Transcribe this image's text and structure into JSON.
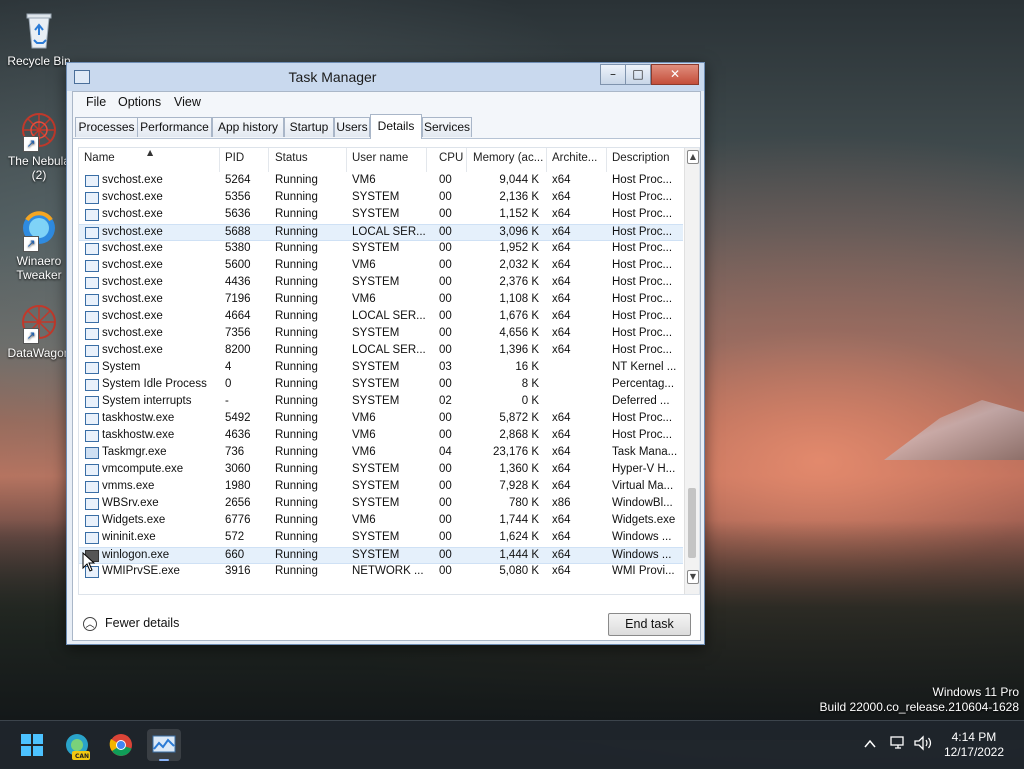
{
  "desktop": {
    "icons": [
      {
        "label": "Recycle Bin"
      },
      {
        "label": "The Nebula (2)"
      },
      {
        "label": "Winaero Tweaker"
      },
      {
        "label": "DataWagon"
      }
    ],
    "watermark": {
      "line1": "Windows 11 Pro",
      "line2": "Build 22000.co_release.210604-1628"
    }
  },
  "window": {
    "title": "Task Manager",
    "controls": {
      "minimize": "–",
      "maximize": "□",
      "close": "✕"
    },
    "menu": [
      "File",
      "Options",
      "View"
    ],
    "tabs": [
      "Processes",
      "Performance",
      "App history",
      "Startup",
      "Users",
      "Details",
      "Services"
    ],
    "active_tab": "Details",
    "columns": [
      "Name",
      "PID",
      "Status",
      "User name",
      "CPU",
      "Memory (ac...",
      "Archite...",
      "Description"
    ],
    "rows": [
      {
        "name": "svchost.exe",
        "pid": "5264",
        "status": "Running",
        "user": "VM6",
        "cpu": "00",
        "mem": "9,044 K",
        "arch": "x64",
        "desc": "Host Proc..."
      },
      {
        "name": "svchost.exe",
        "pid": "5356",
        "status": "Running",
        "user": "SYSTEM",
        "cpu": "00",
        "mem": "2,136 K",
        "arch": "x64",
        "desc": "Host Proc..."
      },
      {
        "name": "svchost.exe",
        "pid": "5636",
        "status": "Running",
        "user": "SYSTEM",
        "cpu": "00",
        "mem": "1,152 K",
        "arch": "x64",
        "desc": "Host Proc..."
      },
      {
        "name": "svchost.exe",
        "pid": "5688",
        "status": "Running",
        "user": "LOCAL SER...",
        "cpu": "00",
        "mem": "3,096 K",
        "arch": "x64",
        "desc": "Host Proc..."
      },
      {
        "name": "svchost.exe",
        "pid": "5380",
        "status": "Running",
        "user": "SYSTEM",
        "cpu": "00",
        "mem": "1,952 K",
        "arch": "x64",
        "desc": "Host Proc..."
      },
      {
        "name": "svchost.exe",
        "pid": "5600",
        "status": "Running",
        "user": "VM6",
        "cpu": "00",
        "mem": "2,032 K",
        "arch": "x64",
        "desc": "Host Proc..."
      },
      {
        "name": "svchost.exe",
        "pid": "4436",
        "status": "Running",
        "user": "SYSTEM",
        "cpu": "00",
        "mem": "2,376 K",
        "arch": "x64",
        "desc": "Host Proc..."
      },
      {
        "name": "svchost.exe",
        "pid": "7196",
        "status": "Running",
        "user": "VM6",
        "cpu": "00",
        "mem": "1,108 K",
        "arch": "x64",
        "desc": "Host Proc..."
      },
      {
        "name": "svchost.exe",
        "pid": "4664",
        "status": "Running",
        "user": "LOCAL SER...",
        "cpu": "00",
        "mem": "1,676 K",
        "arch": "x64",
        "desc": "Host Proc..."
      },
      {
        "name": "svchost.exe",
        "pid": "7356",
        "status": "Running",
        "user": "SYSTEM",
        "cpu": "00",
        "mem": "4,656 K",
        "arch": "x64",
        "desc": "Host Proc..."
      },
      {
        "name": "svchost.exe",
        "pid": "8200",
        "status": "Running",
        "user": "LOCAL SER...",
        "cpu": "00",
        "mem": "1,396 K",
        "arch": "x64",
        "desc": "Host Proc..."
      },
      {
        "name": "System",
        "pid": "4",
        "status": "Running",
        "user": "SYSTEM",
        "cpu": "03",
        "mem": "16 K",
        "arch": "",
        "desc": "NT Kernel ..."
      },
      {
        "name": "System Idle Process",
        "pid": "0",
        "status": "Running",
        "user": "SYSTEM",
        "cpu": "00",
        "mem": "8 K",
        "arch": "",
        "desc": "Percentag..."
      },
      {
        "name": "System interrupts",
        "pid": "-",
        "status": "Running",
        "user": "SYSTEM",
        "cpu": "02",
        "mem": "0 K",
        "arch": "",
        "desc": "Deferred ..."
      },
      {
        "name": "taskhostw.exe",
        "pid": "5492",
        "status": "Running",
        "user": "VM6",
        "cpu": "00",
        "mem": "5,872 K",
        "arch": "x64",
        "desc": "Host Proc..."
      },
      {
        "name": "taskhostw.exe",
        "pid": "4636",
        "status": "Running",
        "user": "VM6",
        "cpu": "00",
        "mem": "2,868 K",
        "arch": "x64",
        "desc": "Host Proc..."
      },
      {
        "name": "Taskmgr.exe",
        "pid": "736",
        "status": "Running",
        "user": "VM6",
        "cpu": "04",
        "mem": "23,176 K",
        "arch": "x64",
        "desc": "Task Mana..."
      },
      {
        "name": "vmcompute.exe",
        "pid": "3060",
        "status": "Running",
        "user": "SYSTEM",
        "cpu": "00",
        "mem": "1,360 K",
        "arch": "x64",
        "desc": "Hyper-V H..."
      },
      {
        "name": "vmms.exe",
        "pid": "1980",
        "status": "Running",
        "user": "SYSTEM",
        "cpu": "00",
        "mem": "7,928 K",
        "arch": "x64",
        "desc": "Virtual Ma..."
      },
      {
        "name": "WBSrv.exe",
        "pid": "2656",
        "status": "Running",
        "user": "SYSTEM",
        "cpu": "00",
        "mem": "780 K",
        "arch": "x86",
        "desc": "WindowBl..."
      },
      {
        "name": "Widgets.exe",
        "pid": "6776",
        "status": "Running",
        "user": "VM6",
        "cpu": "00",
        "mem": "1,744 K",
        "arch": "x64",
        "desc": "Widgets.exe"
      },
      {
        "name": "wininit.exe",
        "pid": "572",
        "status": "Running",
        "user": "SYSTEM",
        "cpu": "00",
        "mem": "1,624 K",
        "arch": "x64",
        "desc": "Windows ..."
      },
      {
        "name": "winlogon.exe",
        "pid": "660",
        "status": "Running",
        "user": "SYSTEM",
        "cpu": "00",
        "mem": "1,444 K",
        "arch": "x64",
        "desc": "Windows ..."
      },
      {
        "name": "WMIPrvSE.exe",
        "pid": "3916",
        "status": "Running",
        "user": "NETWORK ...",
        "cpu": "00",
        "mem": "5,080 K",
        "arch": "x64",
        "desc": "WMI Provi..."
      }
    ],
    "footer": {
      "fewer_details": "Fewer details",
      "end_task": "End task"
    }
  },
  "taskbar": {
    "apps": [
      {
        "icon": "windows-start-icon"
      },
      {
        "icon": "edge-canary-icon",
        "badge": "CAN"
      },
      {
        "icon": "chrome-icon"
      },
      {
        "icon": "task-manager-icon"
      }
    ],
    "clock": {
      "time": "4:14 PM",
      "date": "12/17/2022"
    }
  }
}
